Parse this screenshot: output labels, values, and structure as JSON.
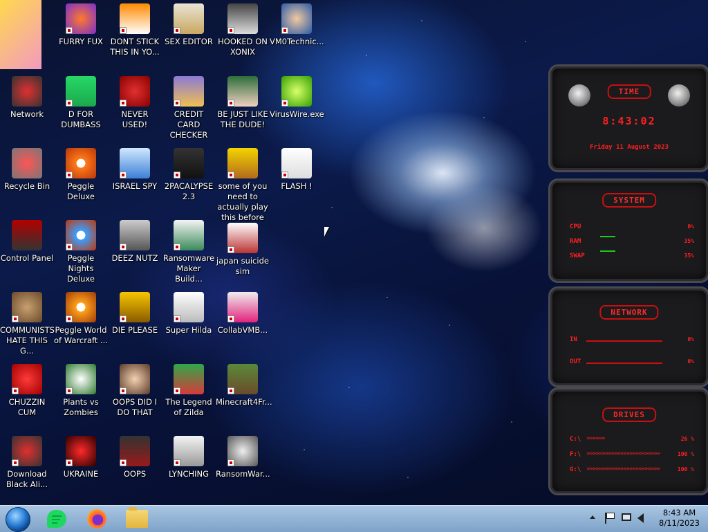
{
  "desktop": {
    "icons": [
      {
        "label": "",
        "col": 0,
        "row": 0
      },
      {
        "label": "FURRY FUX"
      },
      {
        "label": "DONT STICK THIS IN YO..."
      },
      {
        "label": "SEX EDITOR"
      },
      {
        "label": "HOOKED ON XONIX"
      },
      {
        "label": "VM0Technic..."
      },
      {
        "label": "Network"
      },
      {
        "label": "D FOR DUMBASS"
      },
      {
        "label": "NEVER USED!"
      },
      {
        "label": "CREDIT CARD CHECKER"
      },
      {
        "label": "BE JUST LIKE THE DUDE!"
      },
      {
        "label": "VirusWire.exe"
      },
      {
        "label": "Recycle Bin"
      },
      {
        "label": "Peggle Deluxe"
      },
      {
        "label": "ISRAEL SPY"
      },
      {
        "label": "2PACALYPSE 2.3"
      },
      {
        "label": "some of you need to actually play this before using the vm"
      },
      {
        "label": "FLASH !"
      },
      {
        "label": "Control Panel"
      },
      {
        "label": "Peggle Nights Deluxe"
      },
      {
        "label": "DEEZ NUTZ"
      },
      {
        "label": "Ransomware Maker Build..."
      },
      {
        "label": "japan suicide sim"
      },
      {
        "label": "COMMUNISTS HATE THIS G..."
      },
      {
        "label": "Peggle World of Warcraft ..."
      },
      {
        "label": "DIE PLEASE"
      },
      {
        "label": "Super Hilda"
      },
      {
        "label": "CollabVMB..."
      },
      {
        "label": "CHUZZIN CUM"
      },
      {
        "label": "Plants vs Zombies"
      },
      {
        "label": "OOPS DID I DO THAT"
      },
      {
        "label": "The Legend of Zilda"
      },
      {
        "label": "Minecraft4Fr..."
      },
      {
        "label": "Download Black Ali..."
      },
      {
        "label": "UKRAINE"
      },
      {
        "label": "OOPS"
      },
      {
        "label": "LYNCHING"
      },
      {
        "label": "RansomWar..."
      }
    ]
  },
  "gadgets": {
    "time": {
      "title": "TIME",
      "clock": "8:43:02",
      "date": "Friday 11 August 2023"
    },
    "system": {
      "title": "SYSTEM",
      "rows": [
        {
          "label": "CPU",
          "value": "0%"
        },
        {
          "label": "RAM",
          "value": "35%"
        },
        {
          "label": "SWAP",
          "value": "35%"
        }
      ]
    },
    "network": {
      "title": "NETWORK",
      "rows": [
        {
          "label": "IN",
          "value": "0%"
        },
        {
          "label": "OUT",
          "value": "0%"
        }
      ]
    },
    "drives": {
      "title": "DRIVES",
      "rows": [
        {
          "label": "C:\\",
          "value": "26 %"
        },
        {
          "label": "F:\\",
          "value": "100 %"
        },
        {
          "label": "G:\\",
          "value": "100 %"
        }
      ]
    }
  },
  "taskbar": {
    "apps": [
      "start-orb",
      "notes-app",
      "firefox",
      "file-explorer"
    ],
    "clock": {
      "time": "8:43 AM",
      "date": "8/11/2023"
    }
  },
  "colors": {
    "accent_red": "#ff2020",
    "taskbar": "#8eb0d4"
  }
}
